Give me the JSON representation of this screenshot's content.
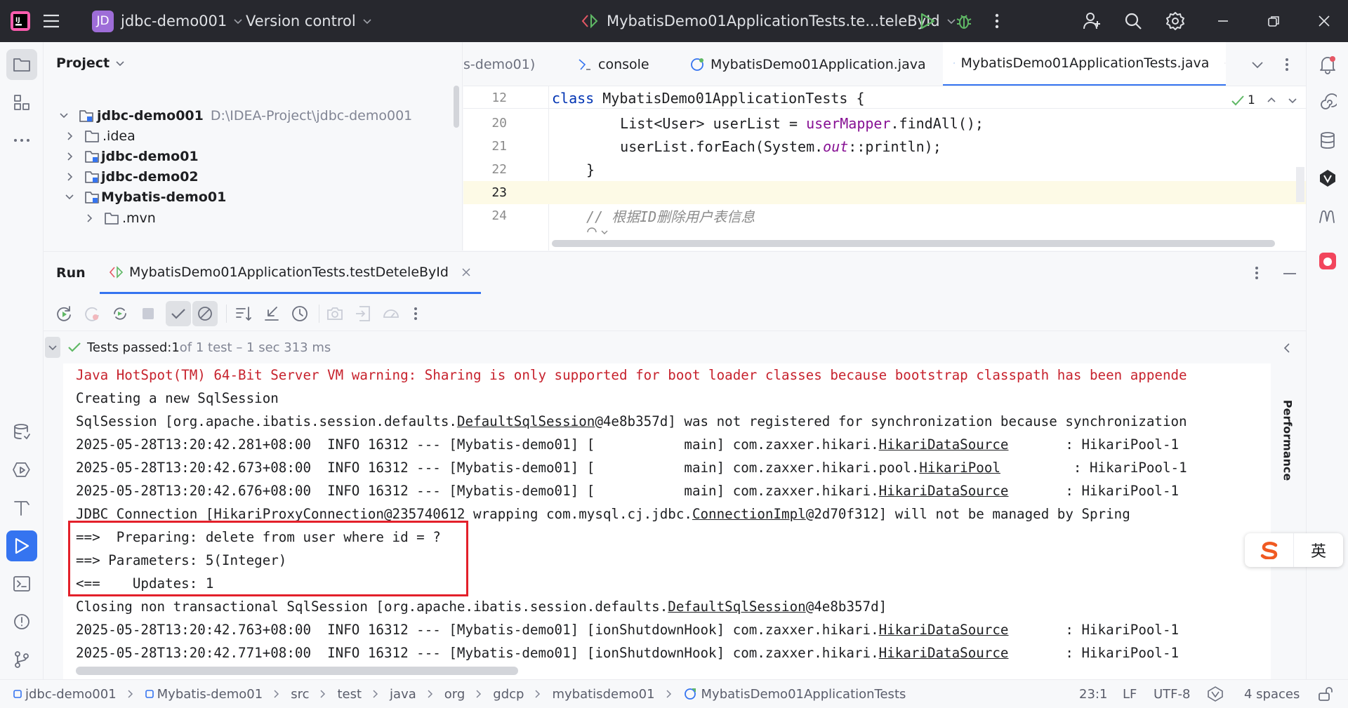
{
  "titlebar": {
    "project_badge": "JD",
    "project_name": "jdbc-demo001",
    "vcs": "Version control",
    "run_config": "MybatisDemo01ApplicationTests.te...teleById"
  },
  "project_panel": {
    "title": "Project",
    "tree": [
      {
        "label": "jdbc-demo001",
        "path": "D:\\IDEA-Project\\jdbc-demo001"
      },
      {
        "label": ".idea"
      },
      {
        "label": "jdbc-demo01"
      },
      {
        "label": "jdbc-demo02"
      },
      {
        "label": "Mybatis-demo01"
      },
      {
        "label": ".mvn"
      }
    ]
  },
  "editor": {
    "tabs": [
      "s-demo01)",
      "console",
      "MybatisDemo01Application.java",
      "MybatisDemo01ApplicationTests.java"
    ],
    "inspection_count": "1",
    "lines": [
      {
        "num": "12",
        "a": "class",
        "b": " MybatisDemo01ApplicationTests {"
      },
      {
        "num": "20",
        "a": "    List<User> userList = ",
        "b": "userMapper",
        "c": ".findAll();"
      },
      {
        "num": "21",
        "a": "    userList.forEach(System.",
        "b": "out",
        "c": "::println);"
      },
      {
        "num": "22",
        "a": "}"
      },
      {
        "num": "23",
        "a": ""
      },
      {
        "num": "24",
        "a": "// 根据ID删除用户表信息"
      }
    ]
  },
  "run": {
    "title": "Run",
    "tab_label": "MybatisDemo01ApplicationTests.testDeteleById",
    "status_prefix": "Tests passed: ",
    "status_count": "1",
    "status_rest": " of 1 test – 1 sec 313 ms",
    "side_label": "Performance",
    "console": [
      {
        "parts": [
          "Java HotSpot(TM) 64-Bit Server VM warning: Sharing is only supported for boot loader classes because bootstrap classpath has been appende"
        ]
      },
      {
        "parts": [
          "Creating a new SqlSession"
        ]
      },
      {
        "parts": [
          "SqlSession [org.apache.ibatis.session.defaults.",
          "DefaultSqlSession",
          "@4e8b357d] was not registered for synchronization because synchronization"
        ]
      },
      {
        "parts": [
          "2025-05-28T13:20:42.281+08:00  INFO 16312 --- [Mybatis-demo01] [           main] com.zaxxer.hikari.",
          "HikariDataSource",
          "       : HikariPool-1"
        ]
      },
      {
        "parts": [
          "2025-05-28T13:20:42.673+08:00  INFO 16312 --- [Mybatis-demo01] [           main] com.zaxxer.hikari.pool.",
          "HikariPool",
          "         : HikariPool-1"
        ]
      },
      {
        "parts": [
          "2025-05-28T13:20:42.676+08:00  INFO 16312 --- [Mybatis-demo01] [           main] com.zaxxer.hikari.",
          "HikariDataSource",
          "       : HikariPool-1"
        ]
      },
      {
        "parts": [
          "JDBC Connection [HikariProxyConnection@235740612 wrapping com.mysql.cj.jdbc.",
          "ConnectionImpl",
          "@2d70f312] will not be managed by Spring"
        ]
      },
      {
        "parts": [
          "==>  Preparing: delete from user where id = ?"
        ]
      },
      {
        "parts": [
          "==> Parameters: 5(Integer)"
        ]
      },
      {
        "parts": [
          "<==    Updates: 1"
        ]
      },
      {
        "parts": [
          "Closing non transactional SqlSession [org.apache.ibatis.session.defaults.",
          "DefaultSqlSession",
          "@4e8b357d]"
        ]
      },
      {
        "parts": [
          "2025-05-28T13:20:42.763+08:00  INFO 16312 --- [Mybatis-demo01] [ionShutdownHook] com.zaxxer.hikari.",
          "HikariDataSource",
          "       : HikariPool-1"
        ]
      },
      {
        "parts": [
          "2025-05-28T13:20:42.771+08:00  INFO 16312 --- [Mybatis-demo01] [ionShutdownHook] com.zaxxer.hikari.",
          "HikariDataSource",
          "       : HikariPool-1"
        ]
      }
    ]
  },
  "statusbar": {
    "crumbs": [
      "jdbc-demo001",
      "Mybatis-demo01",
      "src",
      "test",
      "java",
      "org",
      "gdcp",
      "mybatisdemo01",
      "MybatisDemo01ApplicationTests"
    ],
    "position": "23:1",
    "line_sep": "LF",
    "encoding": "UTF-8",
    "indent": "4 spaces"
  },
  "ime": {
    "lang": "英"
  },
  "colors": {
    "accent": "#3574f0",
    "error_text": "#c7222d",
    "highlight_box": "#e3202a",
    "run_green": "#5fb865"
  }
}
